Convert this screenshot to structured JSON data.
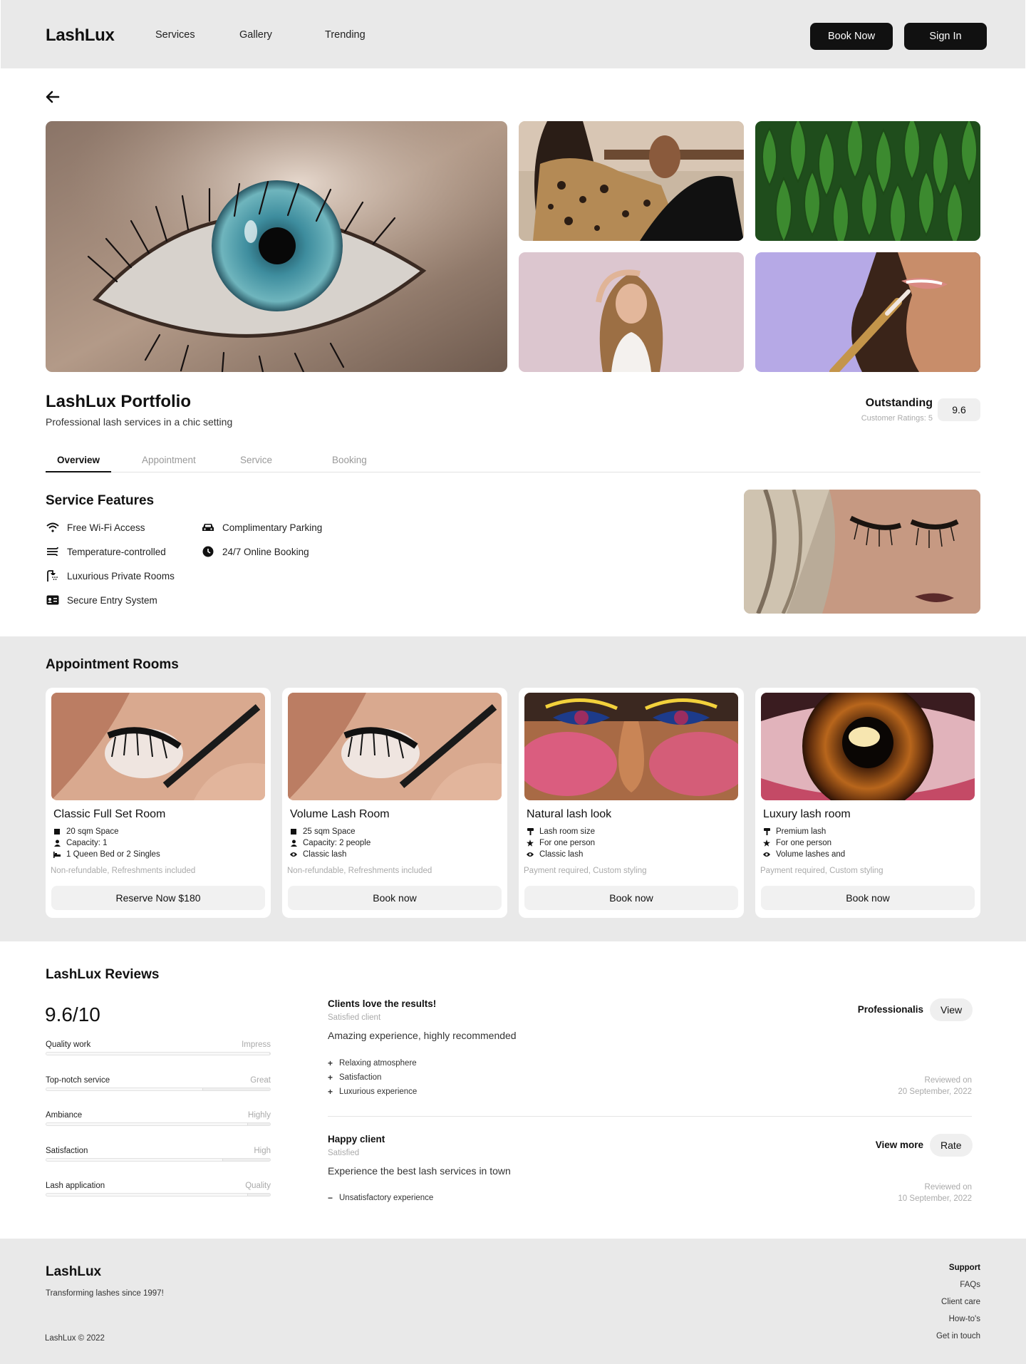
{
  "header": {
    "logo": "LashLux",
    "nav": [
      "Services",
      "Gallery",
      "Trending"
    ],
    "book_now": "Book Now",
    "sign_in": "Sign In"
  },
  "portfolio": {
    "title": "LashLux Portfolio",
    "subtitle": "Professional lash services in a chic setting",
    "rating_label": "Outstanding",
    "rating_sub": "Customer Ratings: 5",
    "rating_score": "9.6"
  },
  "tabs": [
    "Overview",
    "Appointment",
    "Service",
    "Booking"
  ],
  "features": {
    "title": "Service Features",
    "items": [
      {
        "label": "Free Wi-Fi Access",
        "icon": "wifi-icon"
      },
      {
        "label": "Complimentary Parking",
        "icon": "car-icon"
      },
      {
        "label": "Temperature-controlled",
        "icon": "wind-icon"
      },
      {
        "label": "24/7 Online Booking",
        "icon": "clock-icon"
      },
      {
        "label": "Luxurious Private Rooms",
        "icon": "shower-icon"
      },
      {
        "label": "Secure Entry System",
        "icon": "id-card-icon"
      }
    ]
  },
  "rooms": {
    "title": "Appointment Rooms",
    "items": [
      {
        "name": "Classic Full Set Room",
        "features": [
          {
            "label": "20 sqm Space",
            "icon": "square-icon"
          },
          {
            "label": "Capacity: 1",
            "icon": "person-icon"
          },
          {
            "label": "1 Queen Bed or 2 Singles",
            "icon": "bed-icon"
          }
        ],
        "note": "Non-refundable, Refreshments included",
        "button": "Reserve Now $180"
      },
      {
        "name": "Volume Lash Room",
        "features": [
          {
            "label": "25 sqm Space",
            "icon": "square-icon"
          },
          {
            "label": "Capacity: 2 people",
            "icon": "person-icon"
          },
          {
            "label": "Classic lash",
            "icon": "eye-icon"
          }
        ],
        "note": "Non-refundable, Refreshments included",
        "button": "Book now"
      },
      {
        "name": "Natural lash look",
        "features": [
          {
            "label": "Lash room size",
            "icon": "brush-icon"
          },
          {
            "label": "For one person",
            "icon": "star-icon"
          },
          {
            "label": "Classic lash",
            "icon": "eye-icon"
          }
        ],
        "note": "Payment required, Custom styling",
        "button": "Book now"
      },
      {
        "name": "Luxury lash room",
        "features": [
          {
            "label": "Premium lash",
            "icon": "brush-icon"
          },
          {
            "label": "For one person",
            "icon": "star-icon"
          },
          {
            "label": "Volume lashes and",
            "icon": "eye-icon"
          }
        ],
        "note": "Payment required, Custom styling",
        "button": "Book now"
      }
    ]
  },
  "reviews": {
    "title": "LashLux Reviews",
    "score": "9.6/10",
    "bars": [
      {
        "label": "Quality work",
        "value": "Impress",
        "level": 1.0
      },
      {
        "label": "Top-notch service",
        "value": "Great",
        "level": 0.7
      },
      {
        "label": "Ambiance",
        "value": "Highly",
        "level": 0.9
      },
      {
        "label": "Satisfaction",
        "value": "High",
        "level": 0.79
      },
      {
        "label": "Lash application",
        "value": "Quality",
        "level": 0.9
      }
    ],
    "items": [
      {
        "title": "Clients love the results!",
        "sub": "Satisfied client",
        "body": "Amazing experience, highly recommended",
        "points": [
          {
            "mark": "+",
            "text": "Relaxing atmosphere"
          },
          {
            "mark": "+",
            "text": "Satisfaction"
          },
          {
            "mark": "+",
            "text": "Luxurious experience"
          }
        ],
        "tag": "Professionalis",
        "button": "View",
        "reviewed_label": "Reviewed on",
        "date": "20 September, 2022"
      },
      {
        "title": "Happy client",
        "sub": "Satisfied",
        "body": "Experience the best lash services in town",
        "points": [
          {
            "mark": "−",
            "text": "Unsatisfactory experience"
          }
        ],
        "tag": "View more",
        "button": "Rate",
        "reviewed_label": "Reviewed on",
        "date": "10 September, 2022"
      }
    ]
  },
  "footer": {
    "brand": "LashLux",
    "tagline": "Transforming lashes since 1997!",
    "copyright": "LashLux © 2022",
    "support_heading": "Support",
    "links": [
      "FAQs",
      "Client care",
      "How-to's",
      "Get in touch"
    ]
  }
}
